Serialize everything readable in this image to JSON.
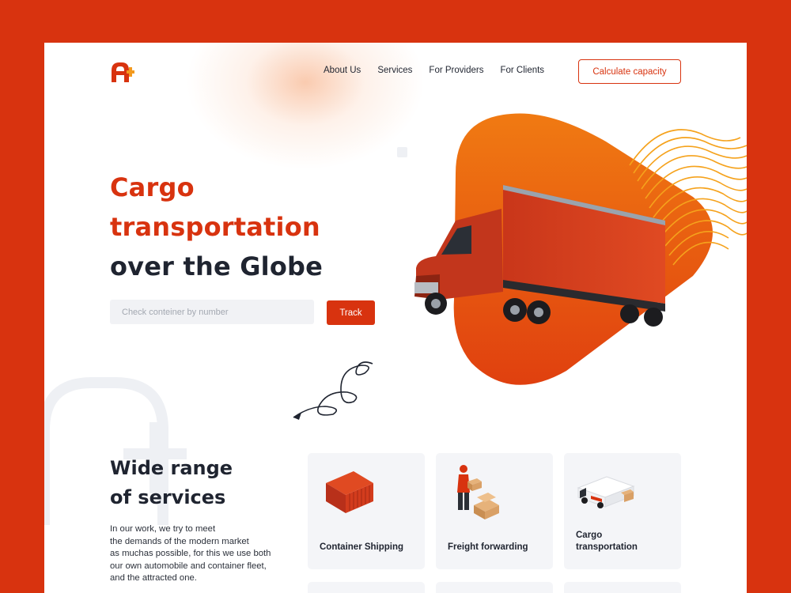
{
  "brand": {
    "logo": "A+ logo",
    "accent": "#d8330f"
  },
  "nav": {
    "items": [
      "About Us",
      "Services",
      "For Providers",
      "For Clients"
    ],
    "cta": "Calculate capacity"
  },
  "hero": {
    "title_line1": "Cargo",
    "title_line2": "transportation",
    "title_line3": "over the Globe",
    "search_placeholder": "Check conteiner by number",
    "track_label": "Track",
    "image": "red semi truck on orange blob"
  },
  "services": {
    "title_line1": "Wide range",
    "title_line2": "of services",
    "description": "In our work, we try to meet\nthe demands of the modern market\nas muchas possible, for this we use both\nour own automobile and container fleet,\nand the attracted one.",
    "cards": [
      {
        "label": "Container Shipping",
        "icon": "shipping-container-icon"
      },
      {
        "label": "Freight forwarding",
        "icon": "courier-boxes-icon"
      },
      {
        "label": "Cargo\ntransportation",
        "icon": "delivery-van-icon"
      }
    ]
  }
}
